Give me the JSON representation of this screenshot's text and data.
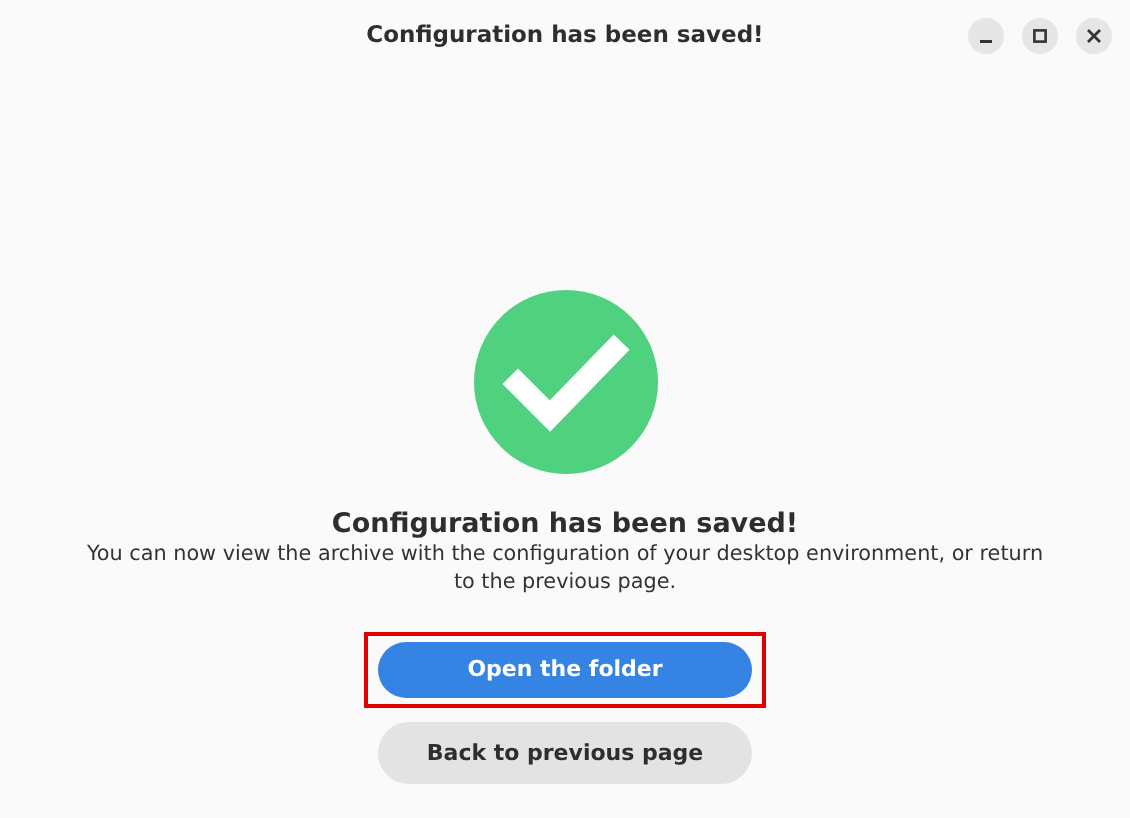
{
  "window": {
    "title": "Configuration has been saved!"
  },
  "status": {
    "heading": "Configuration has been saved!",
    "message": "You can now view the archive with the configuration of your desktop environment, or return to the previous page."
  },
  "buttons": [
    {
      "label": "Open the folder",
      "kind": "primary",
      "highlighted": true
    },
    {
      "label": "Back to previous page",
      "kind": "secondary",
      "highlighted": false
    }
  ]
}
